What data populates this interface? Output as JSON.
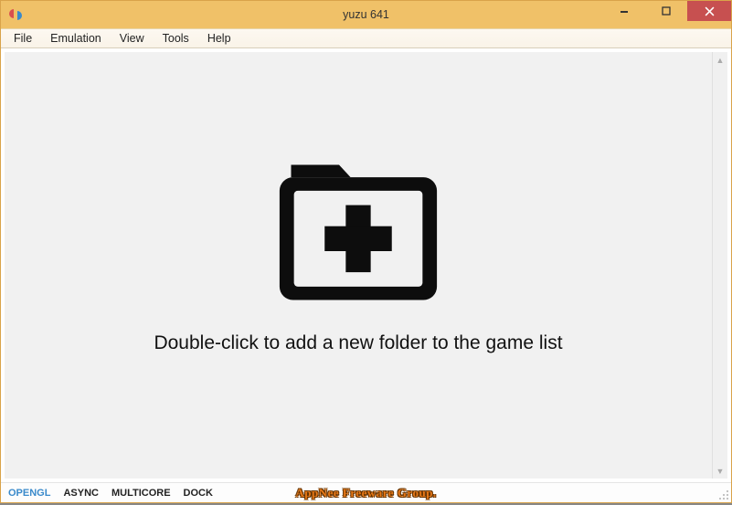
{
  "window": {
    "title": "yuzu 641"
  },
  "menubar": {
    "items": [
      "File",
      "Emulation",
      "View",
      "Tools",
      "Help"
    ]
  },
  "content": {
    "hint": "Double-click to add a new folder to the game list"
  },
  "statusbar": {
    "items": [
      {
        "label": "OPENGL",
        "active": true
      },
      {
        "label": "ASYNC",
        "active": false
      },
      {
        "label": "MULTICORE",
        "active": false
      },
      {
        "label": "DOCK",
        "active": false
      }
    ]
  },
  "watermark": "AppNee Freeware Group."
}
